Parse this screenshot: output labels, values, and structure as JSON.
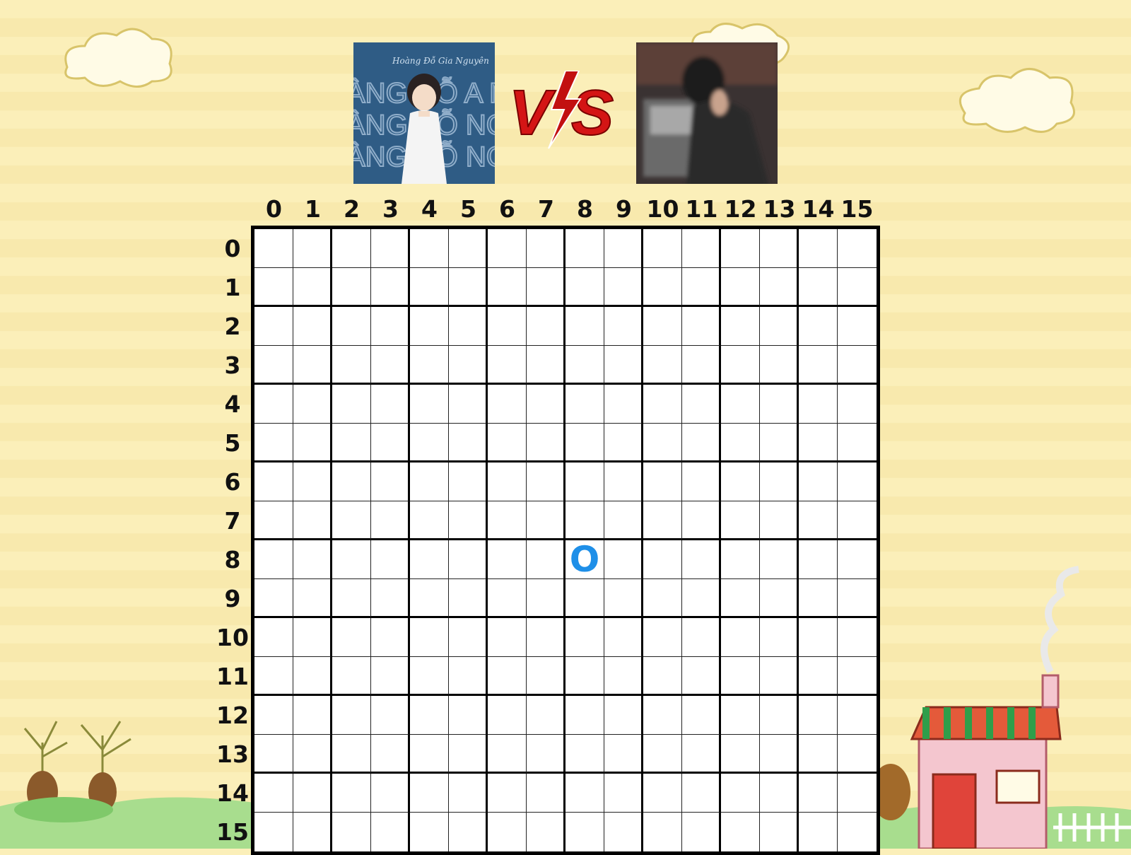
{
  "game": {
    "type": "caro-gomoku",
    "player_left": {
      "avatar": "anime-boy-avatar",
      "name_art_text": "HOÀNG ĐỖ GIA NGUYÊN"
    },
    "player_right": {
      "avatar": "blurred-photo-avatar"
    },
    "vs_label": "VS",
    "vs_color": "#d41515"
  },
  "board": {
    "columns": [
      "0",
      "1",
      "2",
      "3",
      "4",
      "5",
      "6",
      "7",
      "8",
      "9",
      "10",
      "11",
      "12",
      "13",
      "14",
      "15"
    ],
    "rows": [
      "0",
      "1",
      "2",
      "3",
      "4",
      "5",
      "6",
      "7",
      "8",
      "9",
      "10",
      "11",
      "12",
      "13",
      "14",
      "15"
    ],
    "moves": [
      {
        "row": 8,
        "col": 8,
        "mark": "O",
        "color": "#1e8fe8"
      }
    ]
  },
  "colors": {
    "background": "#fbefb9",
    "grid_line": "#000000",
    "o_mark": "#1e8fe8"
  }
}
